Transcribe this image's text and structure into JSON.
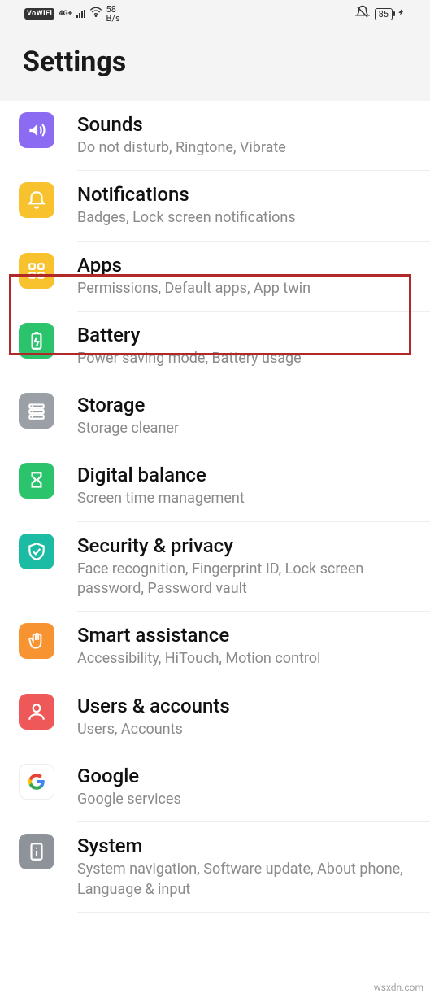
{
  "status": {
    "vowifi": "VoWiFi",
    "network": "4G+",
    "speed_num": "58",
    "speed_unit": "B/s",
    "battery": "85"
  },
  "header": {
    "title": "Settings"
  },
  "items": [
    {
      "id": "sounds",
      "title": "Sounds",
      "sub": "Do not disturb, Ringtone, Vibrate",
      "icon": "sound-icon",
      "bg": "bg-purple"
    },
    {
      "id": "notifications",
      "title": "Notifications",
      "sub": "Badges, Lock screen notifications",
      "icon": "bell-icon",
      "bg": "bg-yellow"
    },
    {
      "id": "apps",
      "title": "Apps",
      "sub": "Permissions, Default apps, App twin",
      "icon": "apps-icon",
      "bg": "bg-yellow"
    },
    {
      "id": "battery",
      "title": "Battery",
      "sub": "Power saving mode, Battery usage",
      "icon": "battery-icon",
      "bg": "bg-green"
    },
    {
      "id": "storage",
      "title": "Storage",
      "sub": "Storage cleaner",
      "icon": "storage-icon",
      "bg": "bg-gray"
    },
    {
      "id": "digital-balance",
      "title": "Digital balance",
      "sub": "Screen time management",
      "icon": "hourglass-icon",
      "bg": "bg-green"
    },
    {
      "id": "security",
      "title": "Security & privacy",
      "sub": "Face recognition, Fingerprint ID, Lock screen password, Password vault",
      "icon": "shield-icon",
      "bg": "bg-teal"
    },
    {
      "id": "smart-assist",
      "title": "Smart assistance",
      "sub": "Accessibility, HiTouch, Motion control",
      "icon": "hand-icon",
      "bg": "bg-orange"
    },
    {
      "id": "users",
      "title": "Users & accounts",
      "sub": "Users, Accounts",
      "icon": "user-icon",
      "bg": "bg-red"
    },
    {
      "id": "google",
      "title": "Google",
      "sub": "Google services",
      "icon": "google-icon",
      "bg": "bg-white"
    },
    {
      "id": "system",
      "title": "System",
      "sub": "System navigation, Software update, About phone, Language & input",
      "icon": "info-icon",
      "bg": "bg-darkgray"
    }
  ],
  "watermark": "wsxdn.com"
}
